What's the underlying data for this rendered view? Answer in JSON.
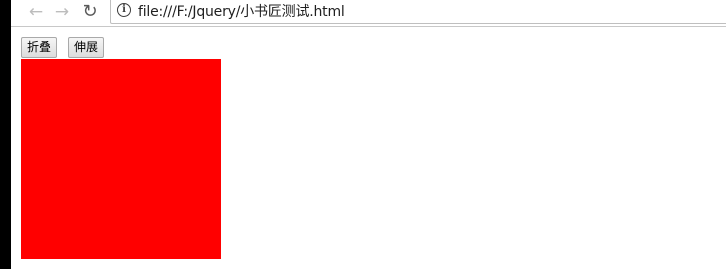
{
  "browser": {
    "back_icon": "back-arrow-icon",
    "forward_icon": "forward-arrow-icon",
    "reload_icon": "reload-icon",
    "info_icon": "info-icon",
    "address": "file:///F:/Jquery/小书匠测试.html"
  },
  "page": {
    "buttons": {
      "fold_label": "折叠",
      "expand_label": "伸展"
    },
    "box": {
      "color": "#ff0000"
    }
  }
}
